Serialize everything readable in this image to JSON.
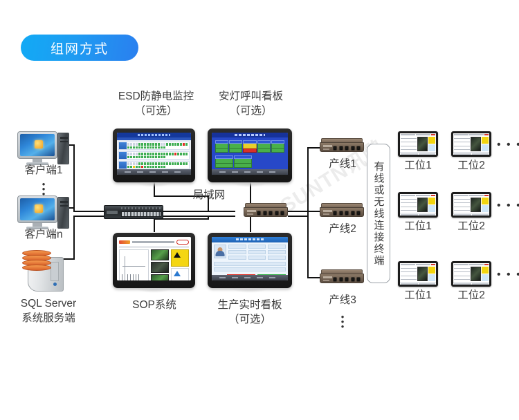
{
  "header": {
    "badge_label": "组网方式"
  },
  "watermark": {
    "text": "SUNTN讯鹏"
  },
  "labels": {
    "esd_title": "ESD防静电监控",
    "esd_optional": "（可选）",
    "andon_title": "安灯呼叫看板",
    "andon_optional": "（可选）",
    "client1": "客户端1",
    "client_n": "客户端n",
    "sql_server": "SQL Server",
    "sql_server_sub": "系统服务端",
    "sop_title": "SOP系统",
    "dashboard_title": "生产实时看板",
    "dashboard_optional": "（可选）",
    "lan": "局域网",
    "line1": "产线1",
    "line2": "产线2",
    "line3": "产线3",
    "terminal_box": "有线或无线连接终端",
    "ws1": "工位1",
    "ws2": "工位2",
    "ellipsis_h": "• • •",
    "dot": "•"
  },
  "colors": {
    "badge_start": "#12AAF5",
    "badge_end": "#2A7FEF",
    "wire": "#111111",
    "text": "#3C3C3C",
    "status_green": "#3FAE54",
    "status_red": "#E03024",
    "status_yellow": "#F0C419",
    "router_body": "#6D5D4E",
    "switch_body": "#24282B",
    "db_orange": "#D9622A"
  },
  "icons": {
    "desktop": "desktop-computer-icon",
    "server": "sql-server-icon",
    "rack_switch": "rack-switch-icon",
    "router": "router-switch-icon",
    "monitor": "monitor-panel-icon",
    "tablet": "workstation-tablet-icon"
  },
  "esd_screen": {
    "rows": [
      [
        "x",
        "x",
        "x",
        "x",
        "g",
        "g",
        "g",
        "g",
        "g",
        "g",
        "g",
        "g",
        "x",
        "x",
        "g",
        "g",
        "g",
        "g",
        "g",
        "g",
        "r",
        "g",
        "g",
        "g",
        "g",
        "g",
        "g",
        "g",
        "g",
        "g",
        "g",
        "g",
        "g",
        "g",
        "g",
        "g"
      ],
      [
        "x",
        "x",
        "x",
        "x",
        "g",
        "g",
        "g",
        "g",
        "g",
        "g",
        "g",
        "g",
        "g",
        "g",
        "g",
        "g",
        "g",
        "r",
        "g",
        "g",
        "g",
        "g",
        "g",
        "g",
        "g",
        "g",
        "g",
        "g",
        "g",
        "g",
        "g",
        "g",
        "g",
        "g",
        "g",
        "g"
      ],
      [
        "x",
        "x",
        "x",
        "x",
        "g",
        "g",
        "g",
        "g",
        "g",
        "g",
        "g",
        "g",
        "g",
        "g",
        "g",
        "g",
        "g",
        "g",
        "g",
        "g",
        "g",
        "g",
        "g",
        "g",
        "y",
        "g",
        "g",
        "r",
        "g",
        "g",
        "g",
        "g",
        "g",
        "g",
        "g",
        "g"
      ],
      [
        "x",
        "x",
        "g",
        "r",
        "g",
        "g",
        "g",
        "g",
        "g",
        "g",
        "g",
        "g",
        "g",
        "g",
        "g",
        "g",
        "g",
        "g",
        "g",
        "g",
        "g",
        "g",
        "g",
        "g",
        "g",
        "g",
        "g",
        "g",
        "g",
        "g",
        "g",
        "g",
        "g",
        "g",
        "g",
        "g"
      ]
    ],
    "legend": [
      "g",
      "x",
      "y",
      "r"
    ]
  },
  "andon_screen": {
    "groups": [
      [
        "g",
        "g",
        "y",
        "g",
        "g"
      ],
      [
        "g",
        "g"
      ],
      [
        "g"
      ]
    ]
  },
  "workstations": {
    "rows": [
      {
        "items": [
          "工位1",
          "工位2"
        ],
        "more": "• • •"
      },
      {
        "items": [
          "工位1",
          "工位2"
        ],
        "more": "• • •"
      },
      {
        "items": [
          "工位1",
          "工位2"
        ],
        "more": "• • •"
      }
    ]
  },
  "production_lines": [
    "产线1",
    "产线2",
    "产线3"
  ]
}
